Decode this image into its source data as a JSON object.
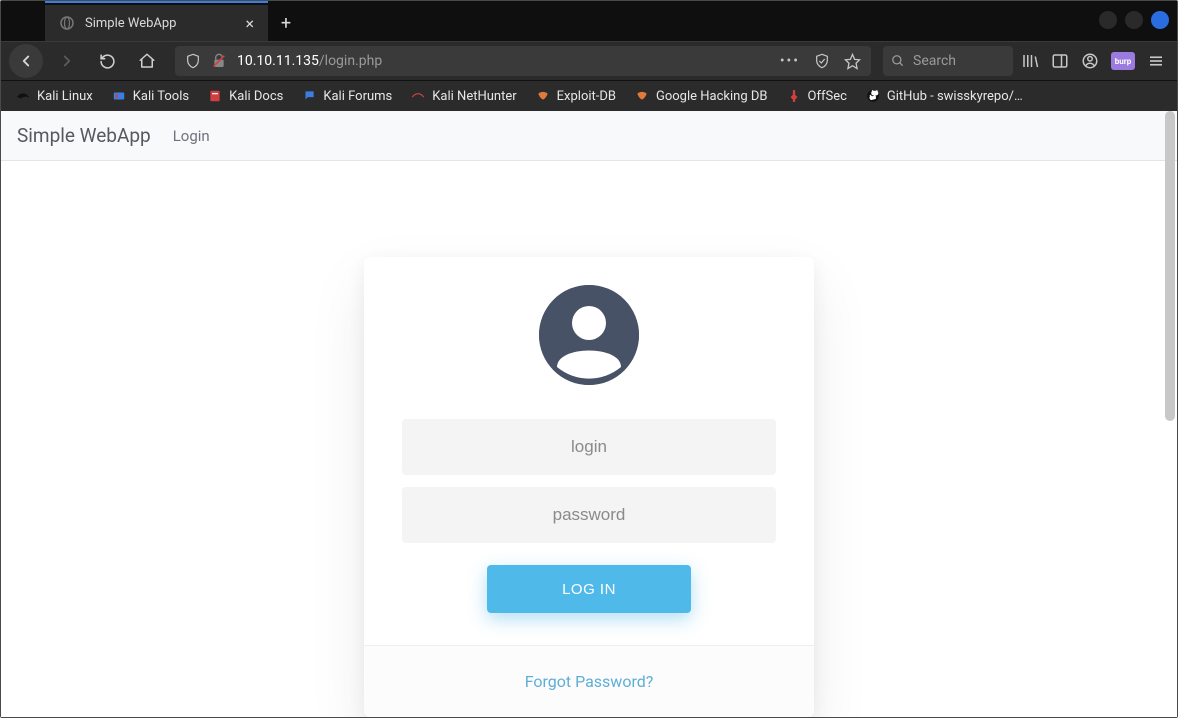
{
  "browser": {
    "tab_title": "Simple WebApp",
    "url_bright": "10.10.11.135",
    "url_dim": "/login.php",
    "search_placeholder": "Search",
    "burp_label": "burp"
  },
  "bookmarks": [
    {
      "label": "Kali Linux",
      "icon": "kali"
    },
    {
      "label": "Kali Tools",
      "icon": "tools"
    },
    {
      "label": "Kali Docs",
      "icon": "docs"
    },
    {
      "label": "Kali Forums",
      "icon": "forums"
    },
    {
      "label": "Kali NetHunter",
      "icon": "nethunter"
    },
    {
      "label": "Exploit-DB",
      "icon": "edb"
    },
    {
      "label": "Google Hacking DB",
      "icon": "ghdb"
    },
    {
      "label": "OffSec",
      "icon": "offsec"
    },
    {
      "label": "GitHub - swisskyrepo/…",
      "icon": "github"
    }
  ],
  "nav": {
    "brand": "Simple WebApp",
    "link_login": "Login"
  },
  "login": {
    "username_placeholder": "login",
    "password_placeholder": "password",
    "submit_label": "LOG IN",
    "forgot_label": "Forgot Password?"
  },
  "colors": {
    "chrome_bg": "#2b2b2b",
    "accent_blue": "#4fb9ea",
    "avatar_bg": "#475266"
  }
}
